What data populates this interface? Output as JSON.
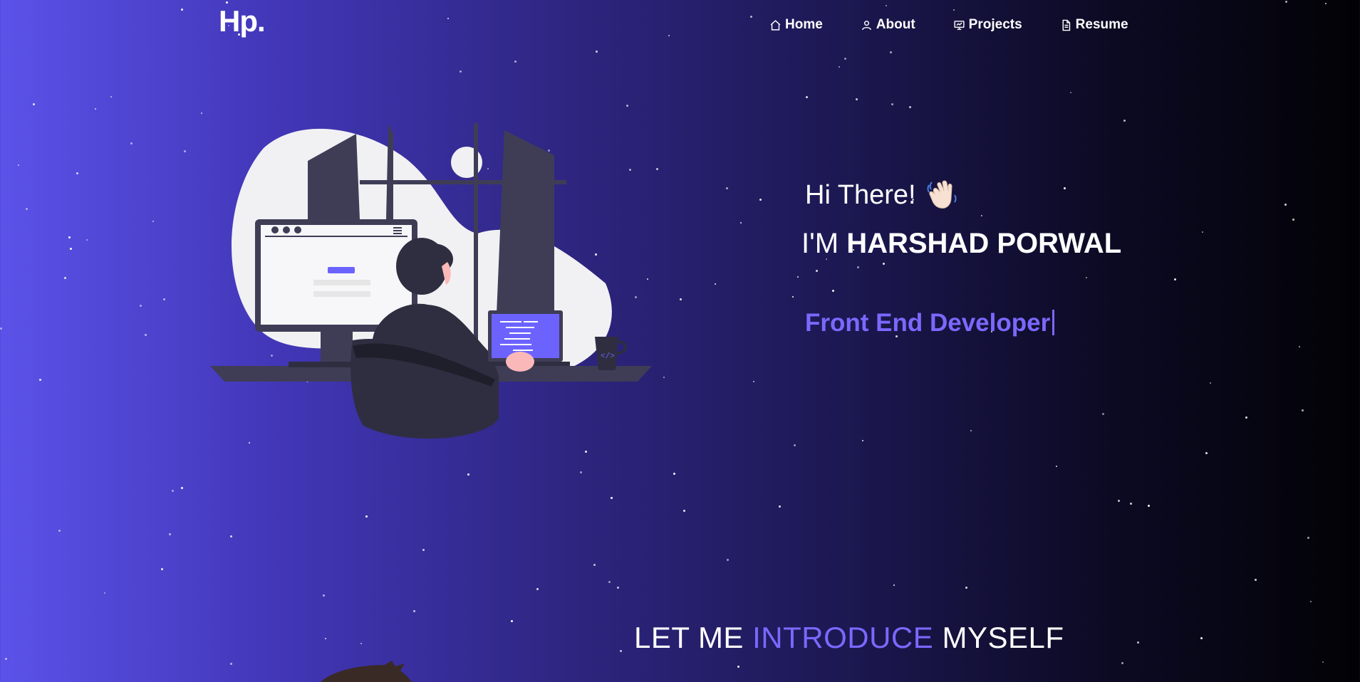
{
  "brand": {
    "logo": "Hp."
  },
  "nav": {
    "items": [
      {
        "label": "Home",
        "icon": "home-icon"
      },
      {
        "label": "About",
        "icon": "user-icon"
      },
      {
        "label": "Projects",
        "icon": "presentation-icon"
      },
      {
        "label": "Resume",
        "icon": "document-icon"
      }
    ]
  },
  "hero": {
    "greeting": "Hi There!",
    "name_prefix": "I'M",
    "name": "HARSHAD PORWAL",
    "role": "Front End Developer",
    "illustration": "developer-at-desk-illustration"
  },
  "intro": {
    "part1": "LET ME",
    "part2": "INTRODUCE",
    "part3": "MYSELF"
  },
  "colors": {
    "accent": "#7b68ff",
    "gradient_start": "#5b52e9",
    "gradient_end": "#020205"
  }
}
